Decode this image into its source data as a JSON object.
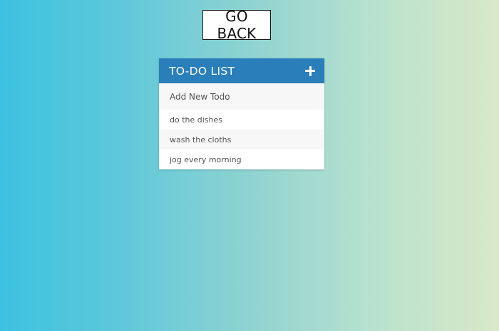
{
  "nav": {
    "go_back_label": "GO BACK"
  },
  "todo": {
    "title": "TO-DO LIST",
    "add_icon": "plus-icon",
    "new_todo_placeholder": "Add New Todo",
    "new_todo_value": "",
    "items": [
      {
        "label": "do the dishes"
      },
      {
        "label": "wash the cloths"
      },
      {
        "label": "jog every morning"
      }
    ]
  },
  "colors": {
    "header": "#2a7fba",
    "gradient_left": "#3cc2e0",
    "gradient_right": "#d9e8c8"
  }
}
